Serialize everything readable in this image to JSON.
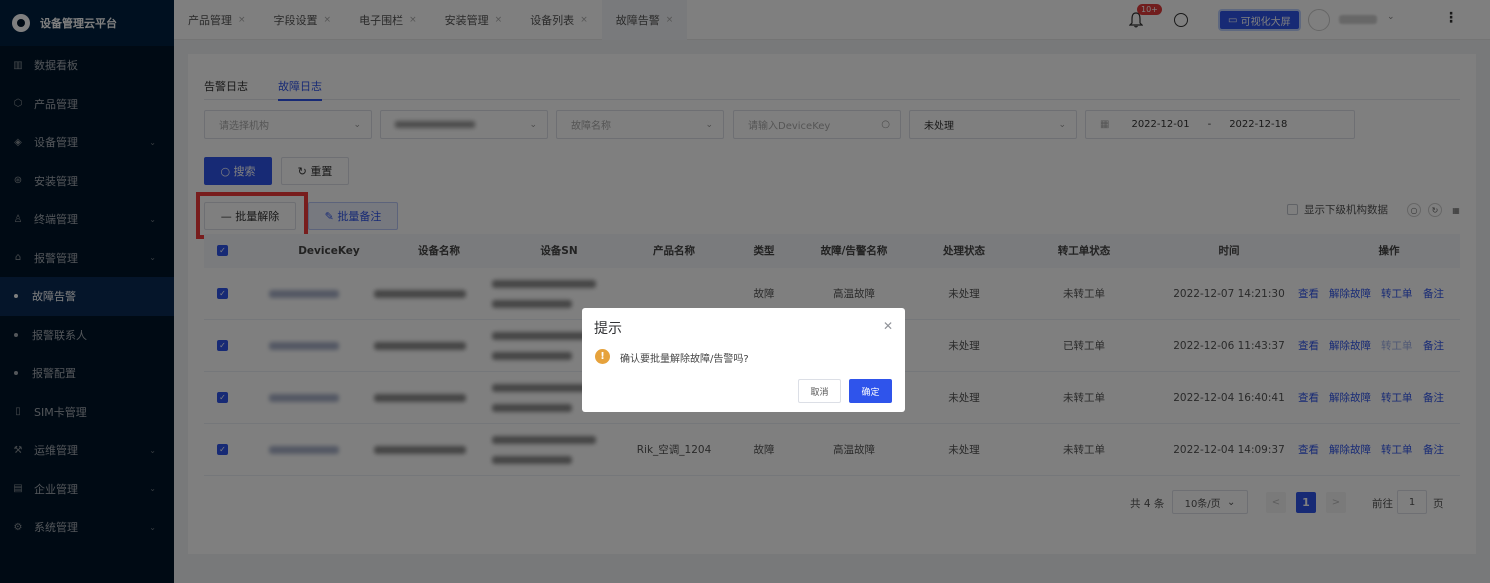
{
  "app": {
    "title": "设备管理云平台"
  },
  "sidebar": {
    "items": [
      {
        "label": "数据看板",
        "icon": "bar-chart-icon",
        "glyph": "▥",
        "chevron": false
      },
      {
        "label": "产品管理",
        "icon": "cube-icon",
        "glyph": "⬡",
        "chevron": false
      },
      {
        "label": "设备管理",
        "icon": "layers-icon",
        "glyph": "◈",
        "chevron": true
      },
      {
        "label": "安装管理",
        "icon": "wrench-icon",
        "glyph": "⊛",
        "chevron": false
      },
      {
        "label": "终端管理",
        "icon": "user-icon",
        "glyph": "♙",
        "chevron": true
      },
      {
        "label": "报警管理",
        "icon": "alarm-icon",
        "glyph": "⌂",
        "chevron": true
      },
      {
        "label": "故障告警",
        "sub": true,
        "active": true
      },
      {
        "label": "报警联系人",
        "sub": true
      },
      {
        "label": "报警配置",
        "sub": true
      },
      {
        "label": "SIM卡管理",
        "icon": "sim-card-icon",
        "glyph": "▯",
        "chevron": false
      },
      {
        "label": "运维管理",
        "icon": "tool-icon",
        "glyph": "⚒",
        "chevron": true
      },
      {
        "label": "企业管理",
        "icon": "building-icon",
        "glyph": "▤",
        "chevron": true
      },
      {
        "label": "系统管理",
        "icon": "settings-icon",
        "glyph": "⚙",
        "chevron": true
      }
    ]
  },
  "topbar": {
    "tabs": [
      {
        "label": "产品管理",
        "close": "×"
      },
      {
        "label": "字段设置",
        "close": "×"
      },
      {
        "label": "电子围栏",
        "close": "×"
      },
      {
        "label": "安装管理",
        "close": "×"
      },
      {
        "label": "设备列表",
        "close": "×"
      },
      {
        "label": "故障告警",
        "close": "×",
        "active": true
      }
    ],
    "notification_badge": "10+",
    "bigscreen_label": "可视化大屏"
  },
  "subtabs": {
    "alarm_log": "告警日志",
    "fault_log": "故障日志"
  },
  "filters": {
    "org_placeholder": "请选择机构",
    "fault_name_placeholder": "故障名称",
    "devicekey_placeholder": "请输入DeviceKey",
    "status_value": "未处理",
    "date_start": "2022-12-01",
    "date_sep": "-",
    "date_end": "2022-12-18",
    "search_label": "搜索",
    "reset_label": "重置"
  },
  "actions": {
    "batch_release_label": "批量解除",
    "batch_note_label": "批量备注",
    "show_sub_org_label": "显示下级机构数据"
  },
  "table": {
    "headers": [
      "DeviceKey",
      "设备名称",
      "设备SN",
      "产品名称",
      "类型",
      "故障/告警名称",
      "处理状态",
      "转工单状态",
      "时间",
      "操作"
    ],
    "rows": [
      {
        "product": "",
        "type": "故障",
        "name": "高温故障",
        "status": "未处理",
        "ticket": "未转工单",
        "time": "2022-12-07 14:21:30",
        "ops": [
          "查看",
          "解除故障",
          "转工单",
          "备注"
        ],
        "ticket_disabled": false
      },
      {
        "product": "",
        "type": "",
        "name": "",
        "status": "未处理",
        "ticket": "已转工单",
        "time": "2022-12-06 11:43:37",
        "ops": [
          "查看",
          "解除故障",
          "转工单",
          "备注"
        ],
        "ticket_disabled": true
      },
      {
        "product": "",
        "type": "",
        "name": "",
        "status": "未处理",
        "ticket": "未转工单",
        "time": "2022-12-04 16:40:41",
        "ops": [
          "查看",
          "解除故障",
          "转工单",
          "备注"
        ],
        "ticket_disabled": false
      },
      {
        "product": "Rik_空调_1204",
        "type": "故障",
        "name": "高温故障",
        "status": "未处理",
        "ticket": "未转工单",
        "time": "2022-12-04 14:09:37",
        "ops": [
          "查看",
          "解除故障",
          "转工单",
          "备注"
        ],
        "ticket_disabled": false
      }
    ]
  },
  "pagination": {
    "total": "共 4 条",
    "page_size": "10条/页",
    "current": "1",
    "goto_prefix": "前往",
    "goto_value": "1",
    "goto_suffix": "页"
  },
  "dialog": {
    "title": "提示",
    "message": "确认要批量解除故障/告警吗?",
    "cancel": "取消",
    "confirm": "确定"
  }
}
